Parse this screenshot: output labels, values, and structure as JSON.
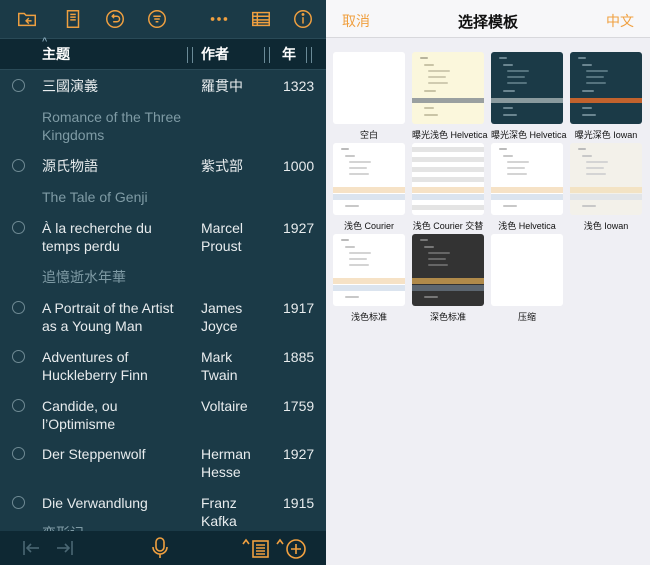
{
  "left": {
    "columns": {
      "title": "主题",
      "author": "作者",
      "year": "年"
    },
    "rows": [
      {
        "title": "三國演義",
        "author": "羅貫中",
        "year": "1323"
      },
      {
        "note": "Romance of the Three Kingdoms"
      },
      {
        "title": "源氏物語",
        "author": "紫式部",
        "year": "1000"
      },
      {
        "note": "The Tale of Genji"
      },
      {
        "title": "À la recherche du temps perdu",
        "author": "Marcel Proust",
        "year": "1927"
      },
      {
        "note": "追憶逝水年華"
      },
      {
        "title": "A Portrait of the Artist as a Young Man",
        "author": "James Joyce",
        "year": "1917"
      },
      {
        "title": "Adventures of Huckleberry Finn",
        "author": "Mark Twain",
        "year": "1885"
      },
      {
        "title": "Candide, ou l’Optimisme",
        "author": "Voltaire",
        "year": "1759"
      },
      {
        "title": "Der Steppenwolf",
        "author": "Herman Hesse",
        "year": "1927"
      },
      {
        "title": "Die Verwandlung",
        "author": "Franz Kafka",
        "year": "1915"
      },
      {
        "note": "变形记"
      }
    ]
  },
  "right": {
    "cancel": "取消",
    "title": "选择模板",
    "lang": "中文",
    "templates": [
      {
        "name": "空白",
        "style": "blank"
      },
      {
        "name": "曝光浅色 Helvetica",
        "style": "cream"
      },
      {
        "name": "曝光深色 Helvetica",
        "style": "dark"
      },
      {
        "name": "曝光深色 Iowan",
        "style": "dark-orange"
      },
      {
        "name": "浅色 Courier",
        "style": "light"
      },
      {
        "name": "浅色 Courier 交替",
        "style": "alt"
      },
      {
        "name": "浅色 Helvetica",
        "style": "light"
      },
      {
        "name": "浅色 Iowan",
        "style": "light2"
      },
      {
        "name": "浅色标准",
        "style": "light"
      },
      {
        "name": "深色标准",
        "style": "darkgray"
      },
      {
        "name": "压缩",
        "style": "blank"
      }
    ]
  },
  "colors": {
    "accent": "#f0a040",
    "dark_bg": "#1b3a47",
    "light_bg": "#efeff4"
  }
}
